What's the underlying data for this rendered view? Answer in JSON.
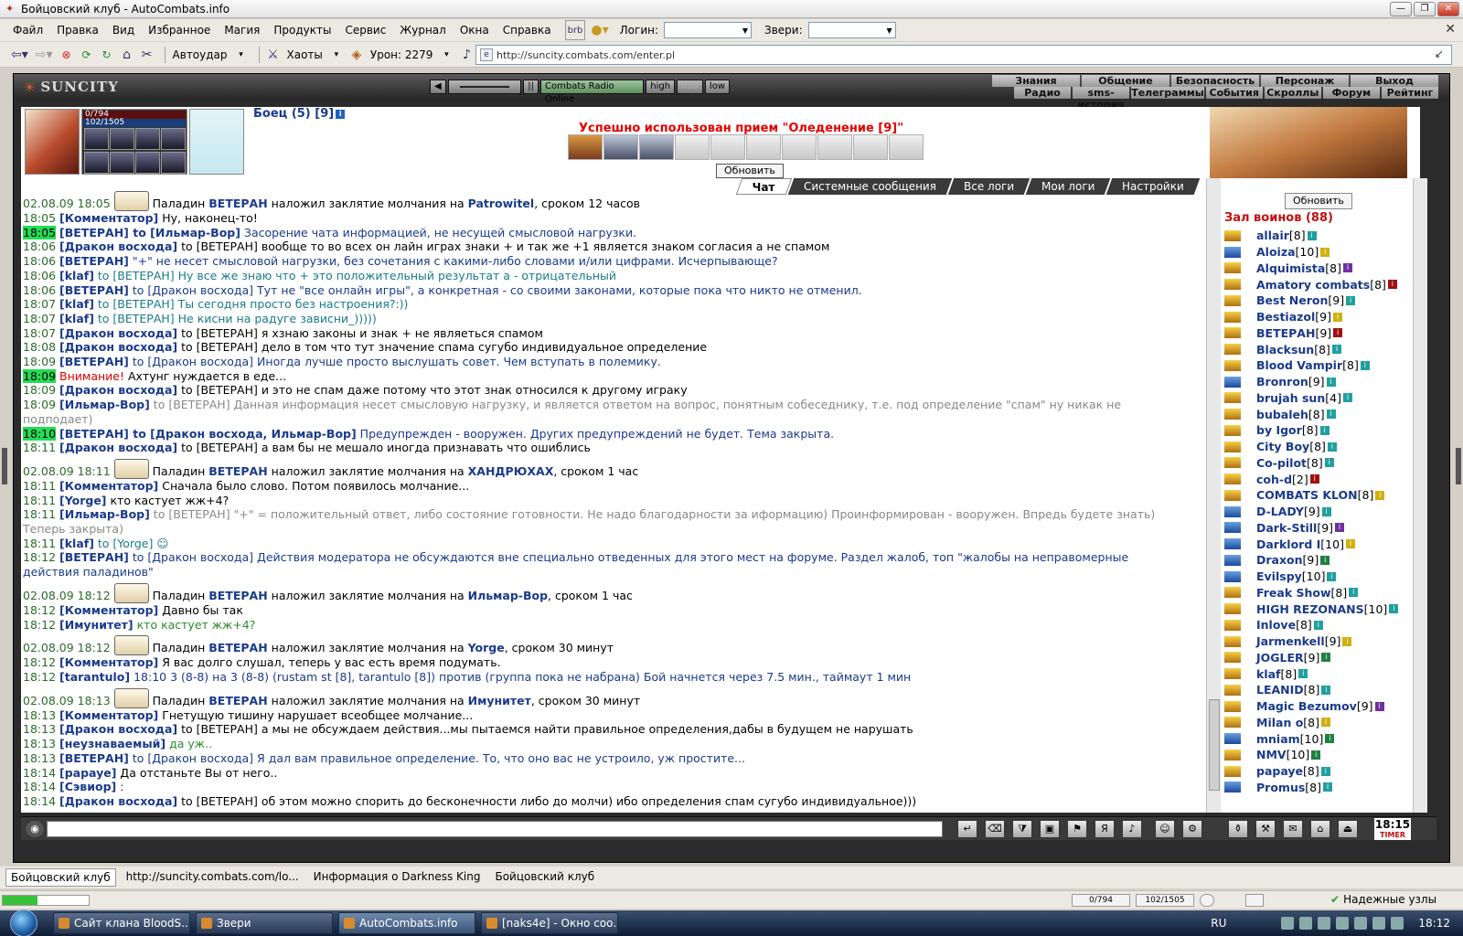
{
  "window": {
    "title": "Бойцовский клуб - AutoCombats.info"
  },
  "menu": {
    "items": [
      "Файл",
      "Правка",
      "Вид",
      "Избранное",
      "Магия",
      "Продукты",
      "Сервис",
      "Журнал",
      "Окна",
      "Справка"
    ],
    "login_label": "Логин:",
    "beasts_label": "Звери:"
  },
  "toolbar": {
    "autoudar": "Автоудар",
    "haoty": "Хаоты",
    "uron": "Урон: 2279",
    "url": "http://suncity.combats.com/enter.pl"
  },
  "game": {
    "logo": "SUNCITY",
    "radio": {
      "station": "Combats Radio Online",
      "q_high": "high",
      "q_mid": "mid",
      "q_low": "low"
    },
    "nav_top": [
      "Знания",
      "Общение",
      "Безопасность",
      "Персонаж",
      "Выход"
    ],
    "nav_sub": [
      "Радио",
      "sms-история",
      "Телеграммы",
      "События",
      "Скроллы",
      "Форум",
      "Рейтинг"
    ],
    "hp": "0/794",
    "mp": "102/1505",
    "fighter": "Боец (5) [9]",
    "message": "Успешно использован прием \"Оледенение [9]\"",
    "refresh": "Обновить",
    "tabs": [
      "Чат",
      "Системные сообщения",
      "Все логи",
      "Мои логи",
      "Настройки"
    ]
  },
  "chat": [
    {
      "sys": true,
      "time": "02.08.09 18:05",
      "pre": "Паладин ",
      "nick": "ВЕТЕРАН",
      "mid": " наложил заклятие молчания на ",
      "target": "Patrowitel",
      "post": ", сроком 12 часов"
    },
    {
      "time": "18:05",
      "who": "[Комментатор]",
      "text": " Ну, наконец-то!",
      "cls": ""
    },
    {
      "time": "18:05",
      "hl": true,
      "who": "[ВЕТЕРАН]",
      "to": " to [Ильмар-Вор]",
      "text": " Засорение чата информацией, не несущей смысловой нагрузки.",
      "cls": "txt-blue",
      "tobold": true
    },
    {
      "time": "18:06",
      "who": "[Дракон восхода]",
      "to": " to [ВЕТЕРАН]",
      "text": " вообще то во всех он лайн играх знаки + и так же +1 является знаком согласия а не спамом",
      "cls": ""
    },
    {
      "time": "18:06",
      "who": "[ВЕТЕРАН]",
      "text": " \"+\" не несет смысловой нагрузки, без сочетания с какими-либо словами и/или цифрами. Исчерпывающе?",
      "cls": "txt-blue"
    },
    {
      "time": "18:06",
      "who": "[klaf]",
      "to": " to [ВЕТЕРАН]",
      "text": " Ну все же знаю что + это положительный результат а - отрицательный",
      "cls": "txt-teal"
    },
    {
      "time": "18:06",
      "who": "[ВЕТЕРАН]",
      "to": " to [Дракон восхода]",
      "text": " Тут не \"все онлайн игры\", а конкретная - со своими законами, которые пока что никто не отменил.",
      "cls": "txt-blue"
    },
    {
      "time": "18:07",
      "who": "[klaf]",
      "to": " to [ВЕТЕРАН]",
      "text": " Ты сегодня просто без настроения?:))",
      "cls": "txt-teal"
    },
    {
      "time": "18:07",
      "who": "[klaf]",
      "to": " to [ВЕТЕРАН]",
      "text": " Не кисни на радуге зависни_)))))",
      "cls": "txt-teal"
    },
    {
      "time": "18:07",
      "who": "[Дракон восхода]",
      "to": " to [ВЕТЕРАН]",
      "text": " я хзнаю законы и знак + не являеться спамом",
      "cls": ""
    },
    {
      "time": "18:08",
      "who": "[Дракон восхода]",
      "to": " to [ВЕТЕРАН]",
      "text": " дело в том что тут значение спама сугубо индивидуальное определение",
      "cls": ""
    },
    {
      "time": "18:09",
      "who": "[ВЕТЕРАН]",
      "to": " to [Дракон восхода]",
      "text": " Иногда лучше просто выслушать совет. Чем вступать в полемику.",
      "cls": "txt-blue"
    },
    {
      "time": "18:09",
      "hl": true,
      "warn": "Внимание!",
      "text": " Ахтунг нуждается в еде...",
      "cls": ""
    },
    {
      "time": "18:09",
      "who": "[Дракон восхода]",
      "to": " to [ВЕТЕРАН]",
      "text": " и это не спам даже потому что этот знак относился к другому играку",
      "cls": ""
    },
    {
      "time": "18:09",
      "who": "[Ильмар-Вор]",
      "to": " to [ВЕТЕРАН]",
      "text": " Данная информация несет смысловую нагрузку, и является ответом на вопрос, понятным собеседнику, т.е. под определение \"спам\" ну никак не подподает)",
      "cls": "txt-gray",
      "wrap": true
    },
    {
      "time": "18:10",
      "hl": true,
      "who": "[ВЕТЕРАН]",
      "to": " to [Дракон восхода, Ильмар-Вор]",
      "text": " Предупрежден - вооружен. Других предупреждений не будет. Тема закрыта.",
      "cls": "txt-blue",
      "tobold": true
    },
    {
      "time": "18:11",
      "who": "[Дракон восхода]",
      "to": " to [ВЕТЕРАН]",
      "text": " а вам бы не мешало иногда признавать что ошиблись",
      "cls": ""
    },
    {
      "sys": true,
      "time": "02.08.09 18:11",
      "pre": "Паладин ",
      "nick": "ВЕТЕРАН",
      "mid": " наложил заклятие молчания на ",
      "target": "ХАНДРЮХАХ",
      "post": ", сроком 1 час"
    },
    {
      "time": "18:11",
      "who": "[Комментатор]",
      "text": " Сначала было слово. Потом появилось молчание...",
      "cls": ""
    },
    {
      "time": "18:11",
      "who": "[Yorge]",
      "text": " кто кастует жж+4?",
      "cls": ""
    },
    {
      "time": "18:11",
      "who": "[Ильмар-Вор]",
      "to": " to [ВЕТЕРАН]",
      "text": " \"+\" = положительный ответ, либо состояние готовности. Не надо благодарности за иформацию) Проинформирован - вооружен. Впредь будете знать) Теперь закрыта)",
      "cls": "txt-gray",
      "wrap": true
    },
    {
      "time": "18:11",
      "who": "[klaf]",
      "to": " to [Yorge]",
      "text": " ☺",
      "cls": "txt-teal"
    },
    {
      "time": "18:12",
      "who": "[ВЕТЕРАН]",
      "to": " to [Дракон восхода]",
      "text": " Действия модератора не обсуждаются вне специально отведенных для этого мест на форуме. Раздел жалоб, топ \"жалобы на неправомерные действия паладинов\"",
      "cls": "txt-blue",
      "wrap": true
    },
    {
      "sys": true,
      "time": "02.08.09 18:12",
      "pre": "Паладин ",
      "nick": "ВЕТЕРАН",
      "mid": " наложил заклятие молчания на ",
      "target": "Ильмар-Вор",
      "post": ", сроком 1 час"
    },
    {
      "time": "18:12",
      "who": "[Комментатор]",
      "text": " Давно бы так",
      "cls": ""
    },
    {
      "time": "18:12",
      "who": "[Имунитет]",
      "text": " кто кастует жж+4?",
      "cls": "txt-green"
    },
    {
      "sys": true,
      "time": "02.08.09 18:12",
      "pre": "Паладин ",
      "nick": "ВЕТЕРАН",
      "mid": " наложил заклятие молчания на ",
      "target": "Yorge",
      "post": ", сроком 30 минут"
    },
    {
      "time": "18:12",
      "who": "[Комментатор]",
      "text": " Я вас долго слушал, теперь у вас есть время подумать.",
      "cls": ""
    },
    {
      "time": "18:12",
      "who": "[tarantulo]",
      "text": " 18:10 3 (8-8) на 3 (8-8) (rustam st [8], tarantulo [8]) против (группа пока не набрана) Бой начнется через 7.5 мин., таймаут 1 мин",
      "cls": "txt-blue"
    },
    {
      "sys": true,
      "time": "02.08.09 18:13",
      "pre": "Паладин ",
      "nick": "ВЕТЕРАН",
      "mid": " наложил заклятие молчания на ",
      "target": "Имунитет",
      "post": ", сроком 30 минут"
    },
    {
      "time": "18:13",
      "who": "[Комментатор]",
      "text": " Гнетущую тишину нарушает всеобщее молчание...",
      "cls": ""
    },
    {
      "time": "18:13",
      "who": "[Дракон восхода]",
      "to": " to [ВЕТЕРАН]",
      "text": " а мы не обсуждаем действия...мы пытаемся найти правильное определения,дабы в будущем не нарушать",
      "cls": ""
    },
    {
      "time": "18:13",
      "who": "[неузнаваемый]",
      "text": " да уж..",
      "cls": "txt-green"
    },
    {
      "time": "18:13",
      "who": "[ВЕТЕРАН]",
      "to": " to [Дракон восхода]",
      "text": " Я дал вам правильное определение. То, что оно вас не устроило, уж простите...",
      "cls": "txt-blue"
    },
    {
      "time": "18:14",
      "who": "[papaye]",
      "text": " Да отстаньте Вы от него..",
      "cls": ""
    },
    {
      "time": "18:14",
      "who": "[Сэвиор]",
      "text": " :",
      "cls": "txt-blue"
    },
    {
      "time": "18:14",
      "who": "[Дракон восхода]",
      "to": " to [ВЕТЕРАН]",
      "text": " об этом можно спорить до бесконечности либо до молчи) ибо определения спам сугубо индивидуальное)))",
      "cls": ""
    }
  ],
  "side": {
    "refresh": "Обновить",
    "title": "Зал воинов (88)",
    "users": [
      {
        "n": "allair",
        "l": "[8]",
        "c": "",
        "a": ""
      },
      {
        "n": "Aloiza",
        "l": "[10]",
        "c": "y",
        "a": "b"
      },
      {
        "n": "Alquimista",
        "l": "[8]",
        "c": "p",
        "a": ""
      },
      {
        "n": "Amatory combats",
        "l": "[8]",
        "c": "r",
        "a": ""
      },
      {
        "n": "Best Neron",
        "l": "[9]",
        "c": "",
        "a": ""
      },
      {
        "n": "Bestiazol",
        "l": "[9]",
        "c": "y",
        "a": ""
      },
      {
        "n": "ВЕТЕРАН",
        "l": "[9]",
        "c": "r",
        "a": ""
      },
      {
        "n": "Blacksun",
        "l": "[8]",
        "c": "",
        "a": ""
      },
      {
        "n": "Blood Vampir",
        "l": "[8]",
        "c": "",
        "a": ""
      },
      {
        "n": "Bronron",
        "l": "[9]",
        "c": "",
        "a": "b"
      },
      {
        "n": "brujah sun",
        "l": "[4]",
        "c": "",
        "a": ""
      },
      {
        "n": "bubaleh",
        "l": "[8]",
        "c": "",
        "a": ""
      },
      {
        "n": "by Igor",
        "l": "[8]",
        "c": "",
        "a": ""
      },
      {
        "n": "City Boy",
        "l": "[8]",
        "c": "",
        "a": ""
      },
      {
        "n": "Co-pilot",
        "l": "[8]",
        "c": "",
        "a": ""
      },
      {
        "n": "coh-d",
        "l": "[2]",
        "c": "r",
        "a": ""
      },
      {
        "n": "COMBATS KLON",
        "l": "[8]",
        "c": "y",
        "a": ""
      },
      {
        "n": "D-LADY",
        "l": "[9]",
        "c": "",
        "a": "b"
      },
      {
        "n": "Dark-Still",
        "l": "[9]",
        "c": "p",
        "a": "b"
      },
      {
        "n": "Darklord I",
        "l": "[10]",
        "c": "y",
        "a": "b"
      },
      {
        "n": "Draxon",
        "l": "[9]",
        "c": "g",
        "a": "b"
      },
      {
        "n": "Evilspy",
        "l": "[10]",
        "c": "",
        "a": "b"
      },
      {
        "n": "Freak Show",
        "l": "[8]",
        "c": "",
        "a": ""
      },
      {
        "n": "HIGH REZONANS",
        "l": "[10]",
        "c": "",
        "a": ""
      },
      {
        "n": "Inlove",
        "l": "[8]",
        "c": "",
        "a": ""
      },
      {
        "n": "Jarmenkell",
        "l": "[9]",
        "c": "y",
        "a": ""
      },
      {
        "n": "JOGLER",
        "l": "[9]",
        "c": "g",
        "a": ""
      },
      {
        "n": "klaf",
        "l": "[8]",
        "c": "",
        "a": ""
      },
      {
        "n": "LEANID",
        "l": "[8]",
        "c": "",
        "a": ""
      },
      {
        "n": "Magic Bezumov",
        "l": "[9]",
        "c": "p",
        "a": ""
      },
      {
        "n": "Milan o",
        "l": "[8]",
        "c": "y",
        "a": ""
      },
      {
        "n": "mniam",
        "l": "[10]",
        "c": "g",
        "a": "b"
      },
      {
        "n": "NMV",
        "l": "[10]",
        "c": "g",
        "a": ""
      },
      {
        "n": "papaye",
        "l": "[8]",
        "c": "",
        "a": ""
      },
      {
        "n": "Promus",
        "l": "[8]",
        "c": "",
        "a": "b"
      }
    ]
  },
  "bottom": {
    "clock": "18:15",
    "timer": "TIMER"
  },
  "tabbar": [
    "Бойцовский клуб",
    "http://suncity.combats.com/lo...",
    "Информация о Darkness King",
    "Бойцовский клуб"
  ],
  "status": {
    "hp": "0/794",
    "mp": "102/1505",
    "safe": "Надежные узлы"
  },
  "taskbar": {
    "items": [
      "Сайт клана BloodS...",
      "Звери",
      "AutoCombats.info",
      "[naks4e] - Окно соо..."
    ],
    "lang": "RU",
    "clock": "18:12"
  }
}
